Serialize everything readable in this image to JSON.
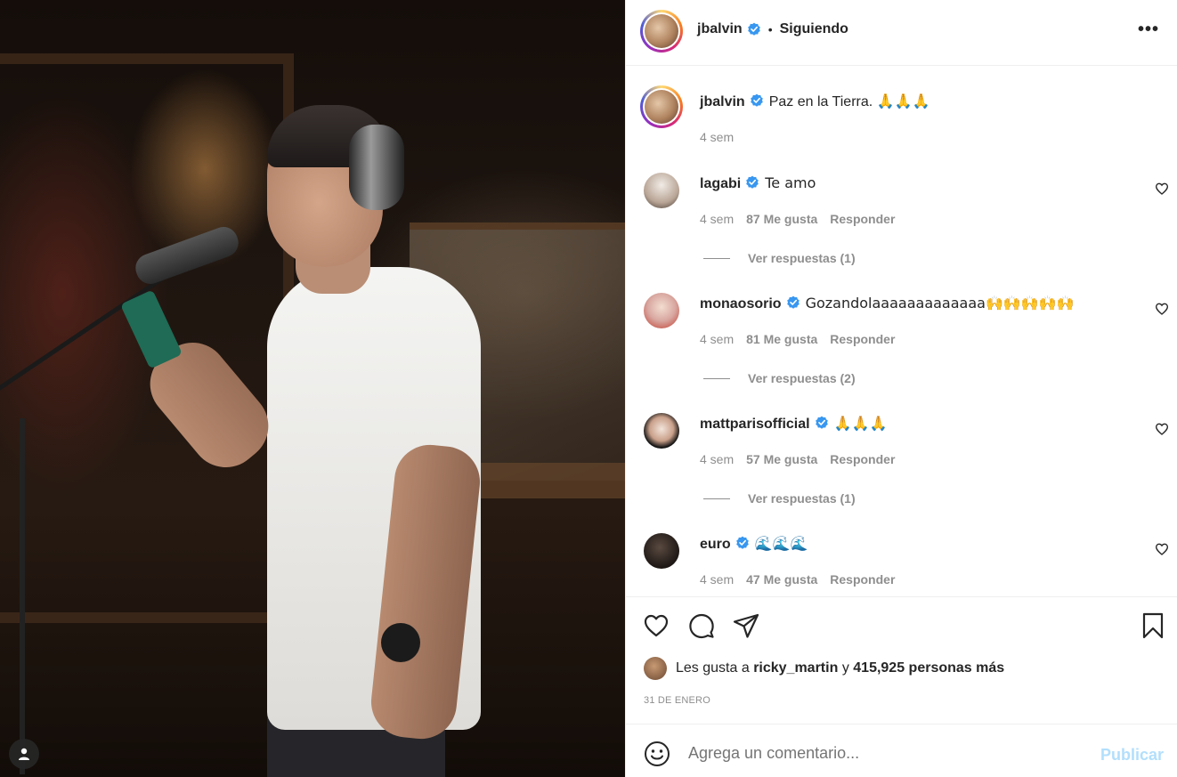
{
  "post": {
    "author": "jbalvin",
    "follow_status": "Siguiendo",
    "caption": "Paz en la Tierra. 🙏🙏🙏",
    "caption_age": "4 sem"
  },
  "comments": [
    {
      "user": "lagabi",
      "text": "Te amo",
      "age": "4 sem",
      "likes": "87 Me gusta",
      "reply": "Responder",
      "replies": "Ver respuestas (1)"
    },
    {
      "user": "monaosorio",
      "text": "Gozandolaaaaaaaaaaaaa🙌🙌🙌🙌🙌",
      "age": "4 sem",
      "likes": "81 Me gusta",
      "reply": "Responder",
      "replies": "Ver respuestas (2)"
    },
    {
      "user": "mattparisofficial",
      "text": "🙏🙏🙏",
      "age": "4 sem",
      "likes": "57 Me gusta",
      "reply": "Responder",
      "replies": "Ver respuestas (1)"
    },
    {
      "user": "euro",
      "text": "🌊🌊🌊",
      "age": "4 sem",
      "likes": "47 Me gusta",
      "reply": "Responder"
    }
  ],
  "likes": {
    "prefix": "Les gusta a",
    "user": "ricky_martin",
    "joiner": "y",
    "count": "415,925 personas más"
  },
  "date": "31 DE ENERO",
  "composer": {
    "placeholder": "Agrega un comentario...",
    "publish": "Publicar"
  },
  "colors": {
    "verified": "#3897f0",
    "publish_disabled": "#b2dffc",
    "muted": "#8e8e8e"
  },
  "icons": [
    "more-options-icon",
    "heart-icon",
    "comment-icon",
    "share-icon",
    "bookmark-icon",
    "emoji-icon",
    "user-tag-icon",
    "verified-badge-icon"
  ]
}
